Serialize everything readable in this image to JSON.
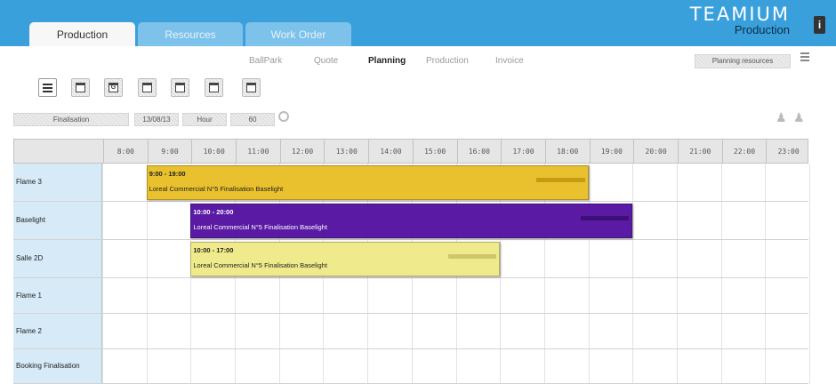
{
  "tabs": [
    {
      "label": "Production",
      "active": true
    },
    {
      "label": "Resources",
      "active": false
    },
    {
      "label": "Work Order",
      "active": false
    }
  ],
  "logo": {
    "brand": "TEAMIUM",
    "product": "Production"
  },
  "info_icon": "info-icon",
  "subnav": [
    {
      "label": "BallPark"
    },
    {
      "label": "Quote"
    },
    {
      "label": "Planning",
      "active": true
    },
    {
      "label": "Production"
    },
    {
      "label": "Invoice"
    }
  ],
  "planning_resources_label": "Planning resources",
  "toolbar_icons": [
    "hamburger-menu-icon",
    "list-view-icon",
    "grid-g-icon",
    "calendar-day-icon",
    "calendar-week-icon",
    "calendar-split-icon",
    "calendar-month-icon"
  ],
  "toolbar_glyphs": [
    "",
    "",
    "G",
    "",
    "",
    "",
    ""
  ],
  "filters": {
    "category": "Finalisation",
    "date": "13/08/13",
    "unit": "Hour",
    "step": "60"
  },
  "hours": [
    "8:00",
    "9:00",
    "10:00",
    "11:00",
    "12:00",
    "13:00",
    "14:00",
    "15:00",
    "16:00",
    "17:00",
    "18:00",
    "19:00",
    "20:00",
    "21:00",
    "22:00",
    "23:00"
  ],
  "resources": [
    "Flame 3",
    "Baselight",
    "Salle 2D",
    "Flame 1",
    "Flame 2",
    "Booking Finalisation"
  ],
  "events": [
    {
      "resource": "Flame 3",
      "start": 9,
      "end": 19,
      "time_label": "9:00 - 19:00",
      "title": "Loreal Commercial N°5 Finalisation Baselight",
      "color": "#e9c12e",
      "text_color": "#222222",
      "stripe_color": "#c79a12"
    },
    {
      "resource": "Baselight",
      "start": 10,
      "end": 20,
      "time_label": "10:00 - 20:00",
      "title": "Loreal Commercial N°5 Finalisation Baselight",
      "color": "#5a1aa4",
      "text_color": "#ffffff",
      "stripe_color": "#3e0f78"
    },
    {
      "resource": "Salle 2D",
      "start": 10,
      "end": 17,
      "time_label": "10:00 - 17:00",
      "title": "Loreal Commercial N°5 Finalisation Baselight",
      "color": "#efeb8c",
      "text_color": "#222222",
      "stripe_color": "#cfc66a"
    }
  ]
}
